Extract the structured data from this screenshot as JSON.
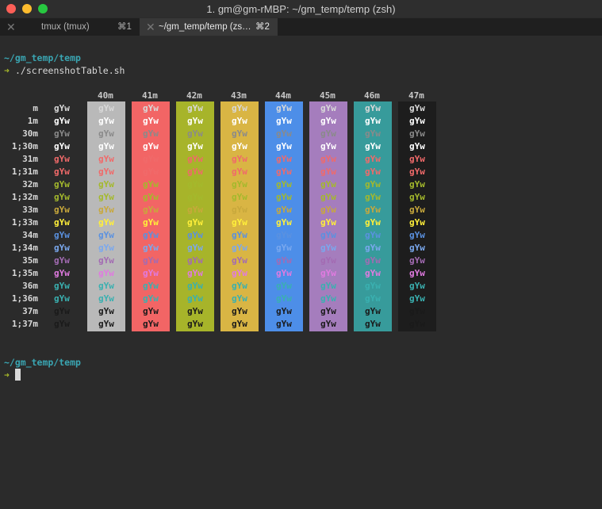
{
  "window": {
    "title": "1. gm@gm-rMBP: ~/gm_temp/temp (zsh)"
  },
  "tabs": [
    {
      "label": "tmux (tmux)",
      "shortcut": "⌘1"
    },
    {
      "label": "~/gm_temp/temp (zs…",
      "shortcut": "⌘2"
    }
  ],
  "terminal": {
    "prompt_path_1": "~/gm_temp/temp",
    "arrow": "➜",
    "command_1": "./screenshotTable.sh",
    "prompt_path_2": "~/gm_temp/temp",
    "sample_text": "gYw",
    "bg_headers": [
      "40m",
      "41m",
      "42m",
      "43m",
      "44m",
      "45m",
      "46m",
      "47m"
    ],
    "fg_rows": [
      "m",
      "1m",
      "30m",
      "1;30m",
      "31m",
      "1;31m",
      "32m",
      "1;32m",
      "33m",
      "1;33m",
      "34m",
      "1;34m",
      "35m",
      "1;35m",
      "36m",
      "1;36m",
      "37m",
      "1;37m"
    ]
  },
  "colors": {
    "path": "#3aa6b3",
    "arrow": "#a6b82a",
    "bg": [
      "#b9b9b9",
      "#f26565",
      "#a7b42a",
      "#d9b544",
      "#4d8ee8",
      "#a57dbd",
      "#379b9b",
      "#1d1d1d"
    ],
    "fg": [
      "#d8d8d8",
      "#ffffff",
      "#8a8a8a",
      "#ffffff",
      "#f06a6a",
      "#f06a6a",
      "#a4b92c",
      "#a4b92c",
      "#c8a83c",
      "#ffef3a",
      "#5a91e0",
      "#7aa8ee",
      "#a36bb3",
      "#e07ae0",
      "#3ab0b0",
      "#3ab0b0",
      "#1a1a1a",
      "#1a1a1a"
    ]
  }
}
